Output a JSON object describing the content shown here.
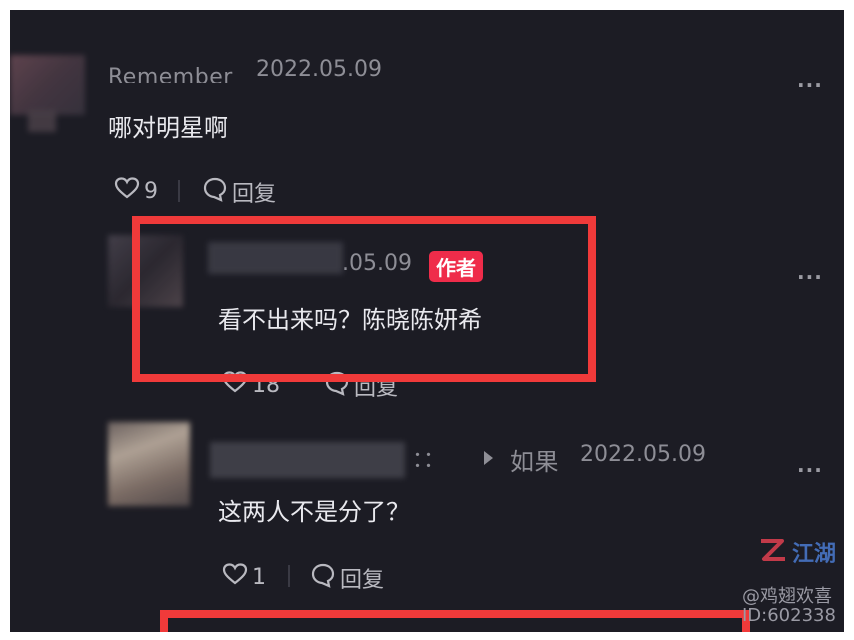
{
  "comment1": {
    "username": "Remember",
    "date": "2022.05.09",
    "text": "哪对明星啊",
    "like_count": "9",
    "reply_label": "回复",
    "more_label": "..."
  },
  "comment2": {
    "date": ".05.09",
    "author_badge": "作者",
    "text": "看不出来吗？陈晓陈妍希",
    "like_count": "18",
    "reply_label": "回复",
    "more_label": "..."
  },
  "comment3": {
    "reply_to_sep": "：：",
    "reply_to": "如果",
    "date": "2022.05.09",
    "text": "这两人不是分了？",
    "like_count": "1",
    "reply_label": "回复",
    "more_label": "..."
  },
  "watermark": {
    "handle": "@鸡翅欢喜",
    "id": "ID:602338",
    "logo_text": "江湖"
  },
  "colors": {
    "background": "#1c1c24",
    "highlight_box": "#f03a3a",
    "author_badge": "#ef2c4a"
  }
}
